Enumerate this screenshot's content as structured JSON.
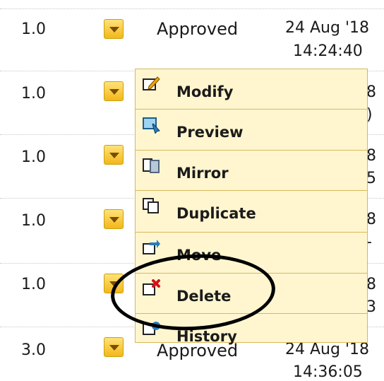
{
  "rows": [
    {
      "version": "1.0",
      "status": "Approved",
      "date": "24 Aug '18",
      "time": "14:24:40",
      "right_date": "",
      "right_time": ""
    },
    {
      "version": "1.0",
      "status": "",
      "date": "",
      "time": "",
      "right_date": "8",
      "right_time": ")"
    },
    {
      "version": "1.0",
      "status": "",
      "date": "",
      "time": "",
      "right_date": "8",
      "right_time": "5"
    },
    {
      "version": "1.0",
      "status": "",
      "date": "",
      "time": "",
      "right_date": "8",
      "right_time": "-"
    },
    {
      "version": "1.0",
      "status": "",
      "date": "",
      "time": "",
      "right_date": "8",
      "right_time": "3"
    },
    {
      "version": "3.0",
      "status": "Approved",
      "date": "24 Aug '18",
      "time": "14:36:05",
      "right_date": "",
      "right_time": ""
    }
  ],
  "menu": {
    "items": [
      {
        "label": "Modify",
        "icon": "edit-pencil-icon"
      },
      {
        "label": "Preview",
        "icon": "preview-icon"
      },
      {
        "label": "Mirror",
        "icon": "mirror-icon"
      },
      {
        "label": "Duplicate",
        "icon": "duplicate-icon"
      },
      {
        "label": "Move",
        "icon": "move-icon"
      },
      {
        "label": "Delete",
        "icon": "delete-icon"
      },
      {
        "label": "History",
        "icon": "history-icon"
      }
    ]
  },
  "colors": {
    "menu_bg": "#fff6cf",
    "menu_border": "#d8b85c",
    "dropdown": "#f3b71a",
    "annotation": "#000000"
  }
}
